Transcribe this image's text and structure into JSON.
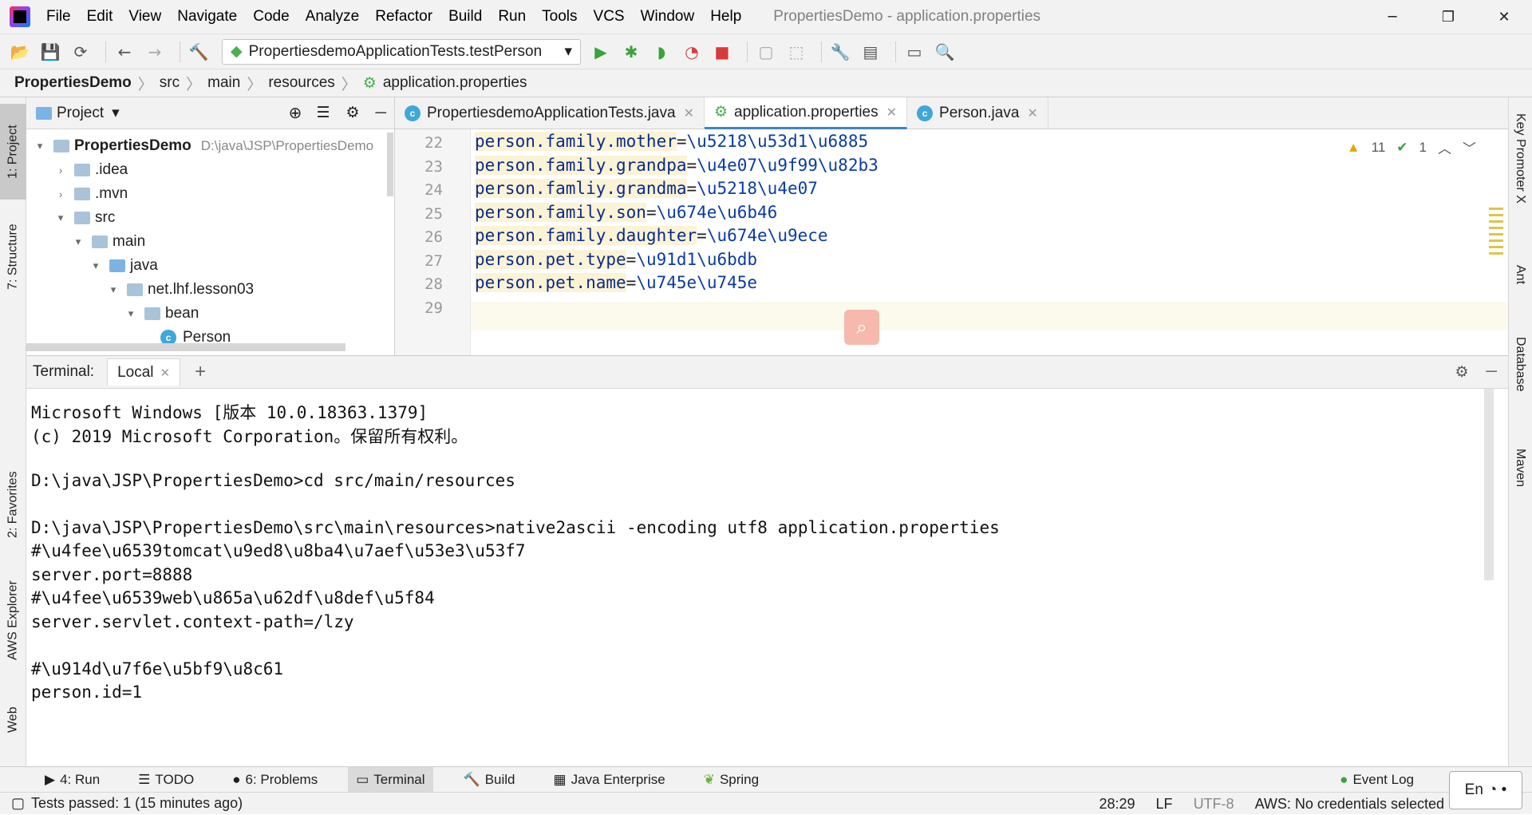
{
  "menu": [
    "File",
    "Edit",
    "View",
    "Navigate",
    "Code",
    "Analyze",
    "Refactor",
    "Build",
    "Run",
    "Tools",
    "VCS",
    "Window",
    "Help"
  ],
  "window_title": "PropertiesDemo - application.properties",
  "run_config": "PropertiesdemoApplicationTests.testPerson",
  "breadcrumb": [
    "PropertiesDemo",
    "src",
    "main",
    "resources",
    "application.properties"
  ],
  "left_tabs": {
    "project": "1: Project",
    "structure": "7: Structure",
    "favorites": "2: Favorites",
    "aws": "AWS Explorer",
    "web": "Web"
  },
  "right_tabs": {
    "key_promoter": "Key Promoter X",
    "ant": "Ant",
    "database": "Database",
    "maven": "Maven"
  },
  "project_panel": {
    "title": "Project",
    "root": "PropertiesDemo",
    "root_path": "D:\\java\\JSP\\PropertiesDemo",
    "items": [
      ".idea",
      ".mvn",
      "src",
      "main",
      "java",
      "net.lhf.lesson03",
      "bean",
      "Person"
    ]
  },
  "editor_tabs": [
    "PropertiesdemoApplicationTests.java",
    "application.properties",
    "Person.java"
  ],
  "editor": {
    "line_numbers": [
      "22",
      "23",
      "24",
      "25",
      "26",
      "27",
      "28",
      "29"
    ],
    "lines": [
      {
        "key": "person.family.mother",
        "val": "\\u5218\\u53d1\\u6885"
      },
      {
        "key": "person.family.grandpa",
        "val": "\\u4e07\\u9f99\\u82b3"
      },
      {
        "key": "person.famliy.grandma",
        "val": "\\u5218\\u4e07"
      },
      {
        "key": "person.family.son",
        "val": "\\u674e\\u6b46"
      },
      {
        "key": "person.family.daughter",
        "val": "\\u674e\\u9ece"
      },
      {
        "key": "person.pet.type",
        "val": "\\u91d1\\u6bdb"
      },
      {
        "key": "person.pet.name",
        "val": "\\u745e\\u745e"
      }
    ],
    "warnings": "11",
    "checks": "1"
  },
  "terminal": {
    "label": "Terminal:",
    "tab": "Local",
    "lines": [
      "Microsoft Windows [版本 10.0.18363.1379]",
      "(c) 2019 Microsoft Corporation。保留所有权利。",
      "",
      "D:\\java\\JSP\\PropertiesDemo>cd src/main/resources",
      "",
      "D:\\java\\JSP\\PropertiesDemo\\src\\main\\resources>native2ascii -encoding utf8 application.properties",
      "#\\u4fee\\u6539tomcat\\u9ed8\\u8ba4\\u7aef\\u53e3\\u53f7",
      "server.port=8888",
      "#\\u4fee\\u6539web\\u865a\\u62df\\u8def\\u5f84",
      "server.servlet.context-path=/lzy",
      "",
      "#\\u914d\\u7f6e\\u5bf9\\u8c61",
      "person.id=1"
    ]
  },
  "bottom_tools": [
    "4: Run",
    "TODO",
    "6: Problems",
    "Terminal",
    "Build",
    "Java Enterprise",
    "Spring"
  ],
  "event_log": "Event Log",
  "status": {
    "message": "Tests passed: 1 (15 minutes ago)",
    "position": "28:29",
    "line_sep": "LF",
    "encoding": "UTF-8",
    "aws": "AWS: No credentials selected"
  },
  "ime": "En"
}
